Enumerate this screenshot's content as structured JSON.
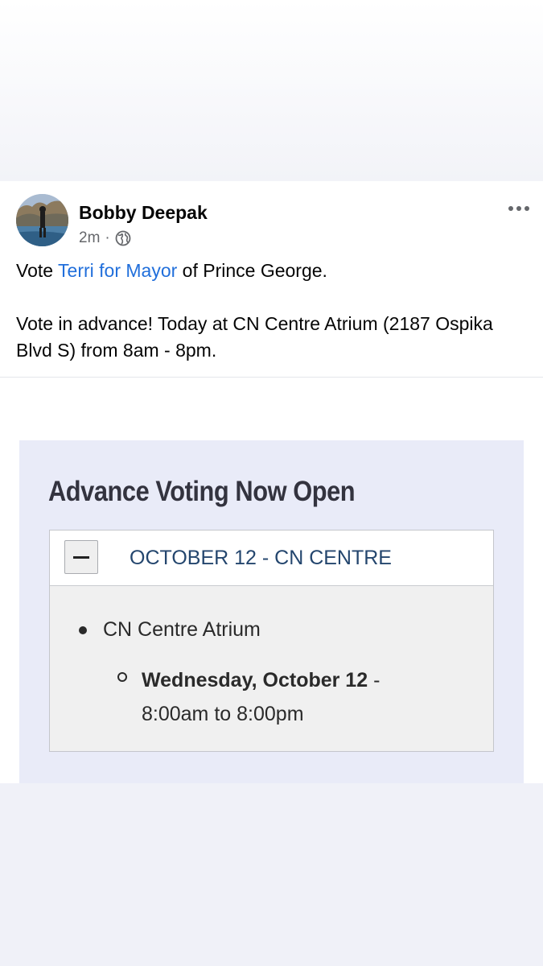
{
  "post": {
    "author": "Bobby Deepak",
    "time": "2m",
    "separator": "·",
    "privacy_icon": "globe-icon",
    "more_icon": "more-horizontal-icon",
    "text": {
      "line1_prefix": "Vote ",
      "line1_link": "Terri for Mayor",
      "line1_suffix": " of Prince George.",
      "line2": "Vote in advance! Today at CN Centre Atrium (2187 Ospika Blvd S) from 8am - 8pm."
    }
  },
  "shared_image": {
    "heading": "Advance Voting Now Open",
    "accordion": {
      "toggle_symbol": "minus-icon",
      "title": "OCTOBER 12 - CN CENTRE",
      "location": "CN Centre Atrium",
      "date": "Wednesday, October 12",
      "date_separator": " -",
      "hours": "8:00am to 8:00pm"
    }
  },
  "colors": {
    "link": "#216fdb",
    "accordion_title": "#24466e",
    "image_background": "#e9ebf8",
    "page_background": "#f0f1f8"
  }
}
